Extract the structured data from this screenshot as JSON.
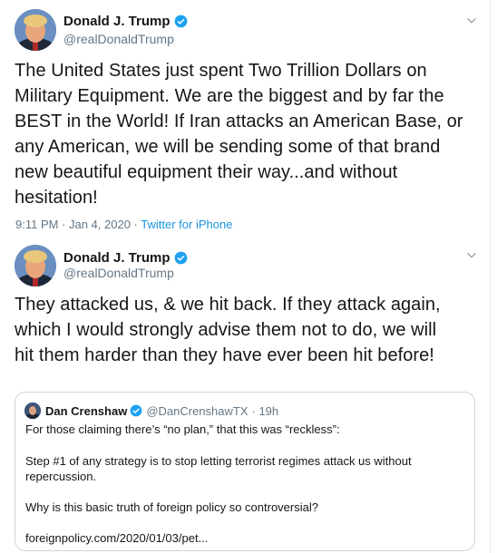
{
  "tweets": [
    {
      "author": {
        "name": "Donald J. Trump",
        "handle": "@realDonaldTrump"
      },
      "lines": [
        "The United States just spent Two Trillion Dollars on",
        "Military Equipment. We are the biggest and by far the",
        "BEST in the World! If Iran attacks an American Base, or",
        "any American, we will be sending some of that brand",
        "new beautiful equipment their way...and without",
        "hesitation!"
      ],
      "timestamp": "9:11 PM · Jan 4, 2020 · ",
      "source": "Twitter for iPhone"
    },
    {
      "author": {
        "name": "Donald J. Trump",
        "handle": "@realDonaldTrump"
      },
      "lines": [
        "They attacked us, & we hit back. If they attack again,",
        "which I would strongly advise them not to do, we will",
        "hit them harder than they have ever been hit before!"
      ],
      "quote": {
        "name": "Dan Crenshaw",
        "handle": "@DanCrenshawTX",
        "time": "· 19h",
        "p1": "For those claiming there’s “no plan,” that this was “reckless”:",
        "p2a": "Step #1 of any strategy is to stop letting terrorist regimes attack us without",
        "p2b": "repercussion.",
        "p3": "Why is this basic truth of foreign policy so controversial?",
        "link": "foreignpolicy.com/2020/01/03/pet..."
      }
    }
  ],
  "colors": {
    "verified": "#1da1f2",
    "link": "#1b95e0",
    "secondary": "#657786"
  }
}
